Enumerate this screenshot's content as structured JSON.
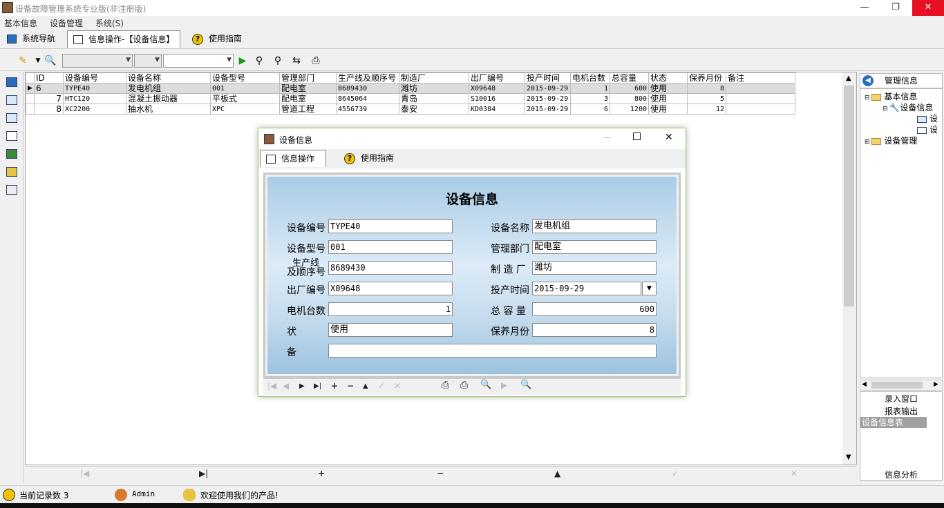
{
  "window": {
    "title": "设备故障管理系统专业版(非注册版)",
    "min": "—",
    "restore": "❐",
    "close": "✕"
  },
  "menu": [
    "基本信息",
    "设备管理",
    "系统(S)"
  ],
  "tabs": [
    {
      "label": "系统导航"
    },
    {
      "label": "信息操作-【设备信息】"
    },
    {
      "label": "使用指南"
    }
  ],
  "grid": {
    "headers": [
      "ID",
      "设备编号",
      "设备名称",
      "设备型号",
      "管理部门",
      "生产线及顺序号",
      "制造厂",
      "出厂编号",
      "投产时间",
      "电机台数",
      "总容量",
      "状态",
      "保养月份",
      "备注"
    ],
    "rows": [
      [
        "6",
        "TYPE40",
        "发电机组",
        "001",
        "配电室",
        "8689430",
        "潍坊",
        "X09648",
        "2015-09-29",
        "1",
        "600",
        "使用",
        "8",
        ""
      ],
      [
        "7",
        "HTC120",
        "混凝土振动器",
        "平板式",
        "配电室",
        "8645064",
        "青岛",
        "S10016",
        "2015-09-29",
        "3",
        "800",
        "使用",
        "5",
        ""
      ],
      [
        "8",
        "XC2200",
        "抽水机",
        "XPC",
        "管道工程",
        "4556739",
        "泰安",
        "KD0384",
        "2015-09-29",
        "6",
        "1200",
        "使用",
        "12",
        ""
      ]
    ]
  },
  "right_panel": {
    "header": "管理信息",
    "tree": [
      "基本信息",
      "设备信息",
      "设",
      "设",
      "设备管理"
    ],
    "list": [
      "录入窗口",
      "报表输出",
      "设备信息表",
      "信息分析"
    ]
  },
  "status": {
    "records": "当前记录数 3",
    "user": "Admin",
    "welcome": "欢迎使用我们的产品!"
  },
  "dialog": {
    "title": "设备信息",
    "tabs": [
      "信息操作",
      "使用指南"
    ],
    "heading": "设备信息",
    "labels": {
      "code": "设备编号",
      "name": "设备名称",
      "model": "设备型号",
      "dept": "管理部门",
      "line1": "生产线",
      "line2": "及顺序号",
      "maker": "制 造 厂",
      "serial": "出厂编号",
      "date": "投产时间",
      "motors": "电机台数",
      "capacity": "总 容 量",
      "status": "状 态",
      "maint": "保养月份",
      "note": "备 注"
    },
    "values": {
      "code": "TYPE40",
      "name": "发电机组",
      "model": "001",
      "dept": "配电室",
      "line": "8689430",
      "maker": "潍坊",
      "serial": "X09648",
      "date": "2015-09-29",
      "motors": "1",
      "capacity": "600",
      "status": "使用",
      "maint": "8",
      "note": ""
    }
  }
}
